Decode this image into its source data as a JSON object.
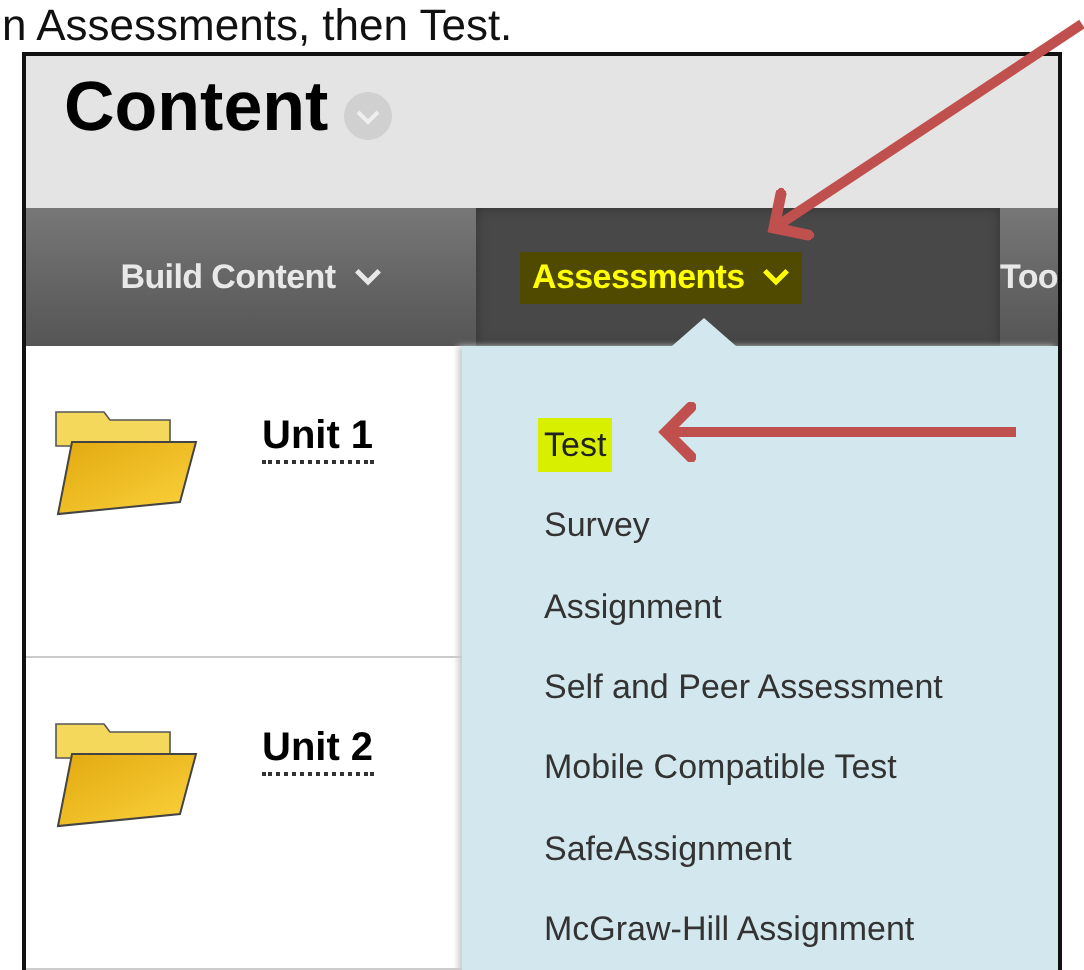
{
  "caption": "n Assessments, then Test.",
  "page_title": "Content",
  "nav_tabs": [
    {
      "label": "Build Content",
      "selected": false,
      "has_caret": true
    },
    {
      "label": "Assessments",
      "selected": true,
      "has_caret": true
    },
    {
      "label": "Too",
      "selected": false,
      "has_caret": false
    }
  ],
  "content_items": [
    {
      "title": "Unit 1"
    },
    {
      "title": "Unit 2"
    }
  ],
  "menu": {
    "items": [
      {
        "label": "Test",
        "highlighted": true
      },
      {
        "label": "Survey",
        "highlighted": false
      },
      {
        "label": "Assignment",
        "highlighted": false
      },
      {
        "label": "Self and Peer Assessment",
        "highlighted": false
      },
      {
        "label": "Mobile Compatible Test",
        "highlighted": false
      },
      {
        "label": "SafeAssignment",
        "highlighted": false
      },
      {
        "label": "McGraw-Hill Assignment",
        "highlighted": false
      }
    ]
  }
}
